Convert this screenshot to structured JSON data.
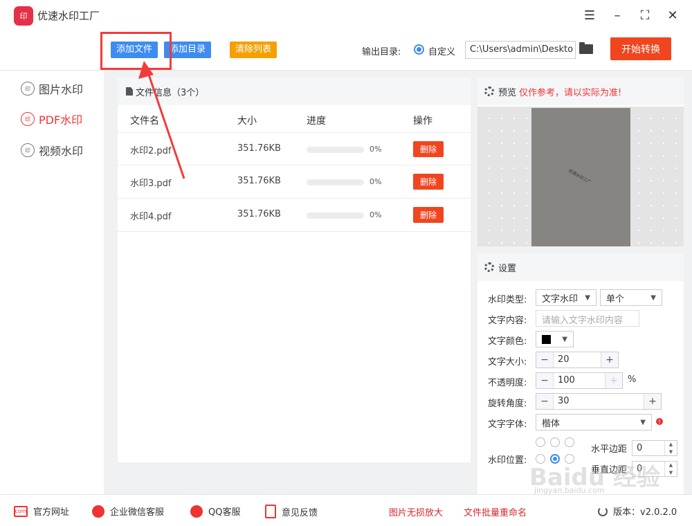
{
  "app": {
    "logo_text": "印",
    "title": "优速水印工厂"
  },
  "window": {
    "menu_glyph": "☰",
    "minimize_glyph": "–",
    "maximize_glyph": "⛶",
    "close_glyph": "✕"
  },
  "toolbar": {
    "add_file": "添加文件",
    "add_folder": "添加目录",
    "clear_list": "清除列表",
    "output_label": "输出目录:",
    "output_option": "自定义",
    "output_path": "C:\\Users\\admin\\Deskto",
    "start_button": "开始转换"
  },
  "sidebar": {
    "items": [
      {
        "icon": "印",
        "label": "图片水印"
      },
      {
        "icon": "印",
        "label": "PDF水印"
      },
      {
        "icon": "印",
        "label": "视频水印"
      }
    ]
  },
  "files": {
    "header": "文件信息（3个）",
    "columns": {
      "name": "文件名",
      "size": "大小",
      "progress": "进度",
      "action": "操作"
    },
    "rows": [
      {
        "name": "水印2.pdf",
        "size": "351.76KB",
        "progress": "0%",
        "action": "删除"
      },
      {
        "name": "水印3.pdf",
        "size": "351.76KB",
        "progress": "0%",
        "action": "删除"
      },
      {
        "name": "水印4.pdf",
        "size": "351.76KB",
        "progress": "0%",
        "action": "删除"
      }
    ]
  },
  "preview": {
    "title": "预览",
    "warning": "仅作参考，请以实际为准!",
    "watermark_text": "优速水印工厂"
  },
  "settings": {
    "title": "设置",
    "watermark_type_label": "水印类型:",
    "watermark_type_value": "文字水印",
    "watermark_mode_value": "单个",
    "text_content_label": "文字内容:",
    "text_content_placeholder": "请输入文字水印内容",
    "text_color_label": "文字颜色:",
    "text_color": "#000000",
    "text_size_label": "文字大小:",
    "text_size": "20",
    "opacity_label": "不透明度:",
    "opacity": "100",
    "percent_sign": "%",
    "rotation_label": "旋转角度:",
    "rotation": "30",
    "font_label": "文字字体:",
    "font_value": "楷体",
    "position_label": "水印位置:",
    "h_margin_label": "水平边距",
    "h_margin": "0",
    "v_margin_label": "垂直边距",
    "v_margin": "0",
    "minus": "−",
    "plus": "+"
  },
  "footer": {
    "website": "官方网址",
    "wechat": "企业微信客服",
    "qq": "QQ客服",
    "feedback": "意见反馈",
    "lossless": "图片无损放大",
    "rename": "文件批量重命名",
    "version": "版本：v2.0.2.0"
  },
  "overlay": {
    "baidu": "Baidu 经验",
    "baidu_sub": "jingyan.baidu.com"
  },
  "colors": {
    "accent_blue": "#3d8cf0",
    "accent_red": "#f0451f",
    "accent_orange": "#f5a000"
  }
}
